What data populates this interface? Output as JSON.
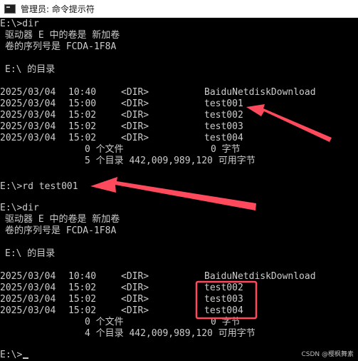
{
  "window": {
    "title": "管理员: 命令提示符",
    "icon": "cmd-icon"
  },
  "colors": {
    "console_bg": "#000000",
    "console_text": "#cccccc",
    "annotation": "#ff4a5d"
  },
  "block1": {
    "prompt": "E:\\>dir",
    "vol_line": "驱动器 E 中的卷是 新加卷",
    "serial_line": "卷的序列号是 FCDA-1F8A",
    "dir_of": "E:\\ 的目录",
    "entries": [
      {
        "date": "2025/03/04",
        "time": "10:40",
        "type": "<DIR>",
        "name": "BaiduNetdiskDownload"
      },
      {
        "date": "2025/03/04",
        "time": "15:00",
        "type": "<DIR>",
        "name": "test001"
      },
      {
        "date": "2025/03/04",
        "time": "15:02",
        "type": "<DIR>",
        "name": "test002"
      },
      {
        "date": "2025/03/04",
        "time": "15:02",
        "type": "<DIR>",
        "name": "test003"
      },
      {
        "date": "2025/03/04",
        "time": "15:02",
        "type": "<DIR>",
        "name": "test004"
      }
    ],
    "files_count": "0 个文件",
    "files_bytes": "0 字节",
    "dirs_summary": "5 个目录 442,009,989,120 可用字节"
  },
  "rd_command": "E:\\>rd test001",
  "block2": {
    "prompt": "E:\\>dir",
    "vol_line": "驱动器 E 中的卷是 新加卷",
    "serial_line": "卷的序列号是 FCDA-1F8A",
    "dir_of": "E:\\ 的目录",
    "entries": [
      {
        "date": "2025/03/04",
        "time": "10:40",
        "type": "<DIR>",
        "name": "BaiduNetdiskDownload"
      },
      {
        "date": "2025/03/04",
        "time": "15:02",
        "type": "<DIR>",
        "name": "test002"
      },
      {
        "date": "2025/03/04",
        "time": "15:02",
        "type": "<DIR>",
        "name": "test003"
      },
      {
        "date": "2025/03/04",
        "time": "15:02",
        "type": "<DIR>",
        "name": "test004"
      }
    ],
    "files_count": "0 个文件",
    "files_bytes": "0 字节",
    "dirs_summary": "4 个目录 442,009,989,120 可用字节"
  },
  "final_prompt": "E:\\>",
  "watermark": "CSDN @樱枫舞素"
}
